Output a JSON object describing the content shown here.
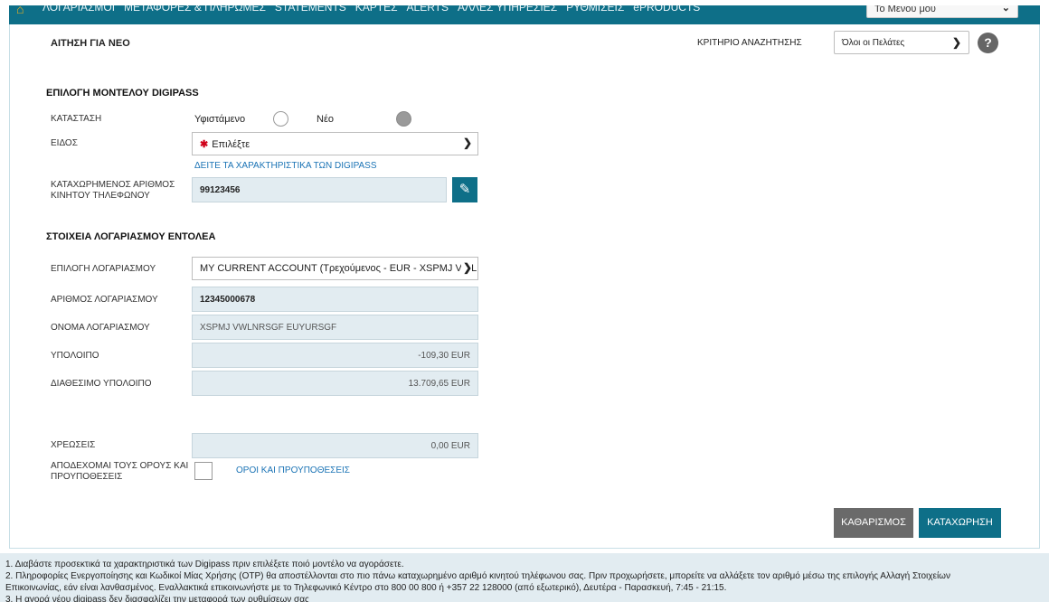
{
  "nav": {
    "items": [
      "ΛΟΓΑΡΙΑΣΜΟΙ",
      "ΜΕΤΑΦΟΡΕΣ & ΠΛΗΡΩΜΕΣ",
      "STATEMENTS",
      "ΚΑΡΤΕΣ",
      "ALERTS",
      "ΑΛΛΕΣ ΥΠΗΡΕΣΙΕΣ",
      "ΡΥΘΜΙΣΕΙΣ",
      "ePRODUCTS"
    ],
    "my_menu": "Το Μενού μου"
  },
  "page": {
    "title": "ΑΙΤΗΣΗ ΓΙΑ ΝΕΟ",
    "criteria_label": "ΚΡΙΤΗΡΙΟ ΑΝΑΖΗΤΗΣΗΣ",
    "criteria_value": "Όλοι οι Πελάτες",
    "help": "?"
  },
  "digipass": {
    "section_title": "ΕΠΙΛΟΓΗ ΜΟΝΤΕΛΟΥ DIGIPASS",
    "status_label": "ΚΑΤΑΣΤΑΣΗ",
    "existing_label": "Υφιστάμενο",
    "new_label": "Νέο",
    "selected": "Νέο",
    "type_label": "ΕΙΔΟΣ",
    "type_placeholder": "Επιλέξτε",
    "features_link": "ΔΕΙΤΕ ΤΑ ΧΑΡΑΚΤΗΡΙΣΤΙΚΑ ΤΩΝ DIGIPASS",
    "phone_label_1": "ΚΑΤΑΧΩΡΗΜΕΝΟΣ ΑΡΙΘΜΟΣ",
    "phone_label_2": "ΚΙΝΗΤΟΥ ΤΗΛΕΦΩΝΟΥ",
    "phone_value": "99123456"
  },
  "account": {
    "section_title": "ΣΤΟΙΧΕΙΑ ΛΟΓΑΡΙΑΣΜΟΥ ΕΝΤΟΛΕΑ",
    "select_label": "ΕΠΙΛΟΓΗ ΛΟΓΑΡΙΑΣΜΟΥ",
    "select_value": "MY CURRENT ACCOUNT (Τρεχούμενος - EUR - XSPMJ VWLN",
    "number_label": "ΑΡΙΘΜΟΣ ΛΟΓΑΡΙΑΣΜΟΥ",
    "number_value": "12345000678",
    "name_label": "ΟΝΟΜΑ ΛΟΓΑΡΙΑΣΜΟΥ",
    "name_value": "XSPMJ VWLNRSGF EUYURSGF",
    "balance_label": "ΥΠΟΛΟΙΠΟ",
    "balance_value": "-109,30 EUR",
    "available_label": "ΔΙΑΘΕΣΙΜΟ ΥΠΟΛΟΙΠΟ",
    "available_value": "13.709,65 EUR"
  },
  "charges": {
    "label": "ΧΡΕΩΣΕΙΣ",
    "value": "0,00 EUR",
    "terms_label_1": "ΑΠΟΔΕΧΟΜΑΙ ΤΟΥΣ ΟΡΟΥΣ ΚΑΙ",
    "terms_label_2": "ΠΡΟΥΠΟΘΕΣΕΙΣ",
    "terms_link": "ΟΡΟΙ ΚΑΙ ΠΡΟΥΠΟΘΕΣΕΙΣ"
  },
  "buttons": {
    "clear": "ΚΑΘΑΡΙΣΜΟΣ",
    "submit": "ΚΑΤΑΧΩΡΗΣΗ"
  },
  "notes": [
    "1. Διαβάστε προσεκτικά τα χαρακτηριστικά των Digipass πριν επιλέξετε ποιό μοντέλο να αγοράσετε.",
    "2. Πληροφορίες Ενεργοποίησης και Κωδικοί Μίας Χρήσης (OTP) θα αποστέλλονται στο πιο πάνω καταχωρημένο αριθμό κινητού τηλέφωνου σας. Πριν προχωρήσετε, μπορείτε να αλλάξετε τον αριθμό μέσω της επιλογής Αλλαγή Στοιχείων",
    "Επικοινωνίας, εάν είναι λανθασμένος. Εναλλακτικά επικοινωνήστε με το Τηλεφωνικό Κέντρο στο 800 00 800 ή +357 22 128000 (από εξωτερικό), Δευτέρα - Παρασκευή, 7:45 - 21:15.",
    "3. Η αγορά νέου digipass δεν διασφαλίζει την μεταφορά των ρυθμίσεων σας"
  ]
}
